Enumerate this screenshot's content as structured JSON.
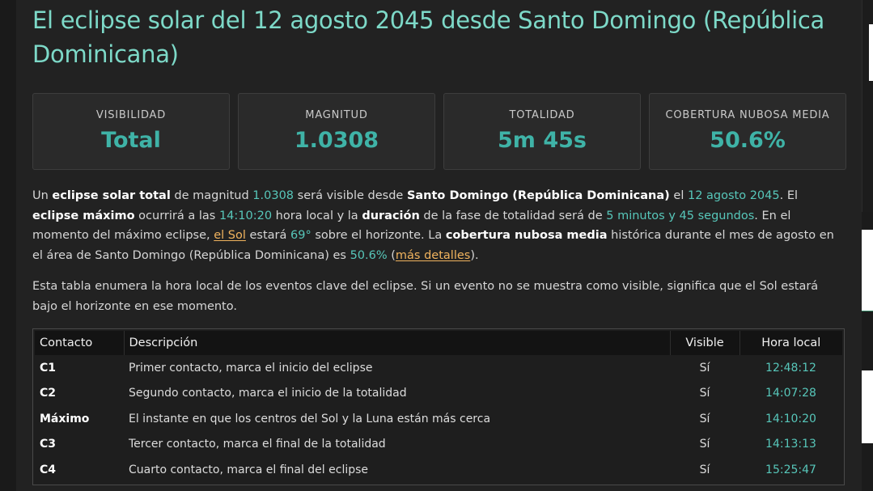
{
  "title": "El eclipse solar del 12 agosto 2045 desde Santo Domingo (República Dominicana)",
  "stats": [
    {
      "label": "VISIBILIDAD",
      "value": "Total"
    },
    {
      "label": "MAGNITUD",
      "value": "1.0308"
    },
    {
      "label": "TOTALIDAD",
      "value": "5m 45s"
    },
    {
      "label": "COBERTURA NUBOSA MEDIA",
      "value": "50.6%"
    }
  ],
  "paragraph1": {
    "t1": "Un ",
    "b1": "eclipse solar total",
    "t2": " de magnitud ",
    "h1": "1.0308",
    "t3": " será visible desde ",
    "b2": "Santo Domingo (República Dominicana)",
    "t4": " el ",
    "h2": "12 agosto 2045",
    "t5": ". El ",
    "b3": "eclipse máximo",
    "t6": " ocurrirá a las ",
    "h3": "14:10:20",
    "t7": " hora local y la ",
    "b4": "duración",
    "t8": " de la fase de totalidad será de ",
    "h4": "5 minutos y 45 segundos",
    "t9": ". En el momento del máximo eclipse, ",
    "l1": "el Sol",
    "t10": " estará ",
    "h5": "69°",
    "t11": " sobre el horizonte. La ",
    "b5": "cobertura nubosa media",
    "t12": " histórica durante el mes de agosto en el área de Santo Domingo (República Dominicana) es ",
    "h6": "50.6%",
    "t13": " (",
    "l2": "más detalles",
    "t14": ")."
  },
  "paragraph2": "Esta tabla enumera la hora local de los eventos clave del eclipse. Si un evento no se muestra como visible, significa que el Sol estará bajo el horizonte en ese momento.",
  "table": {
    "headers": [
      "Contacto",
      "Descripción",
      "Visible",
      "Hora local"
    ],
    "rows": [
      {
        "contact": "C1",
        "description": "Primer contacto, marca el inicio del eclipse",
        "visible": "Sí",
        "time": "12:48:12"
      },
      {
        "contact": "C2",
        "description": "Segundo contacto, marca el inicio de la totalidad",
        "visible": "Sí",
        "time": "14:07:28"
      },
      {
        "contact": "Máximo",
        "description": "El instante en que los centros del Sol y la Luna están más cerca",
        "visible": "Sí",
        "time": "14:10:20"
      },
      {
        "contact": "C3",
        "description": "Tercer contacto, marca el final de la totalidad",
        "visible": "Sí",
        "time": "14:13:13"
      },
      {
        "contact": "C4",
        "description": "Cuarto contacto, marca el final del eclipse",
        "visible": "Sí",
        "time": "15:25:47"
      }
    ]
  }
}
